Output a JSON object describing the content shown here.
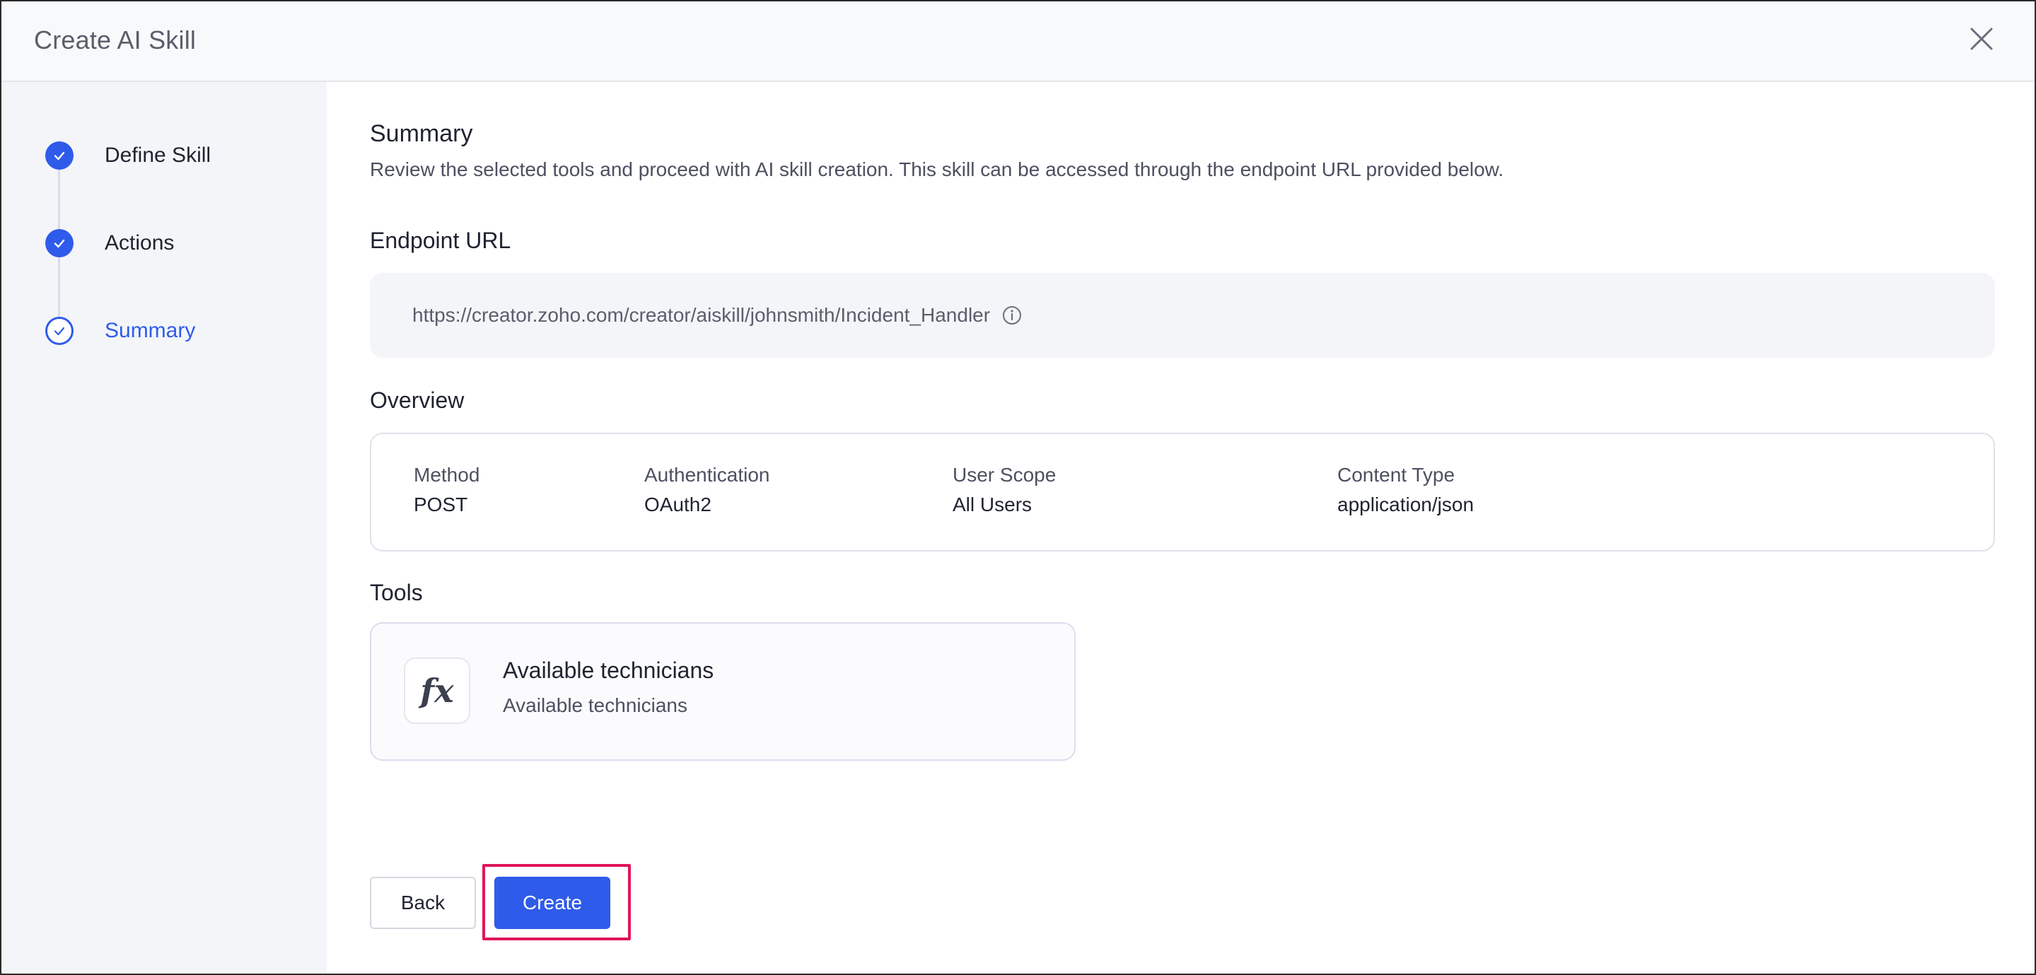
{
  "dialog": {
    "title": "Create AI Skill"
  },
  "steps": [
    {
      "label": "Define Skill",
      "status": "complete"
    },
    {
      "label": "Actions",
      "status": "complete"
    },
    {
      "label": "Summary",
      "status": "current"
    }
  ],
  "summary": {
    "title": "Summary",
    "description": "Review the selected tools and proceed with AI skill creation. This skill can be accessed through the endpoint URL provided below."
  },
  "endpoint": {
    "title": "Endpoint URL",
    "url": "https://creator.zoho.com/creator/aiskill/johnsmith/Incident_Handler"
  },
  "overview": {
    "title": "Overview",
    "fields": [
      {
        "label": "Method",
        "value": "POST"
      },
      {
        "label": "Authentication",
        "value": "OAuth2"
      },
      {
        "label": "User Scope",
        "value": "All Users"
      },
      {
        "label": "Content Type",
        "value": "application/json"
      }
    ]
  },
  "tools": {
    "title": "Tools",
    "items": [
      {
        "icon": "function-icon",
        "glyph": "fx",
        "name": "Available technicians",
        "description": "Available technicians"
      }
    ]
  },
  "actions": {
    "back_label": "Back",
    "create_label": "Create"
  },
  "colors": {
    "accent": "#2f5bea",
    "highlight": "#e0165a"
  }
}
